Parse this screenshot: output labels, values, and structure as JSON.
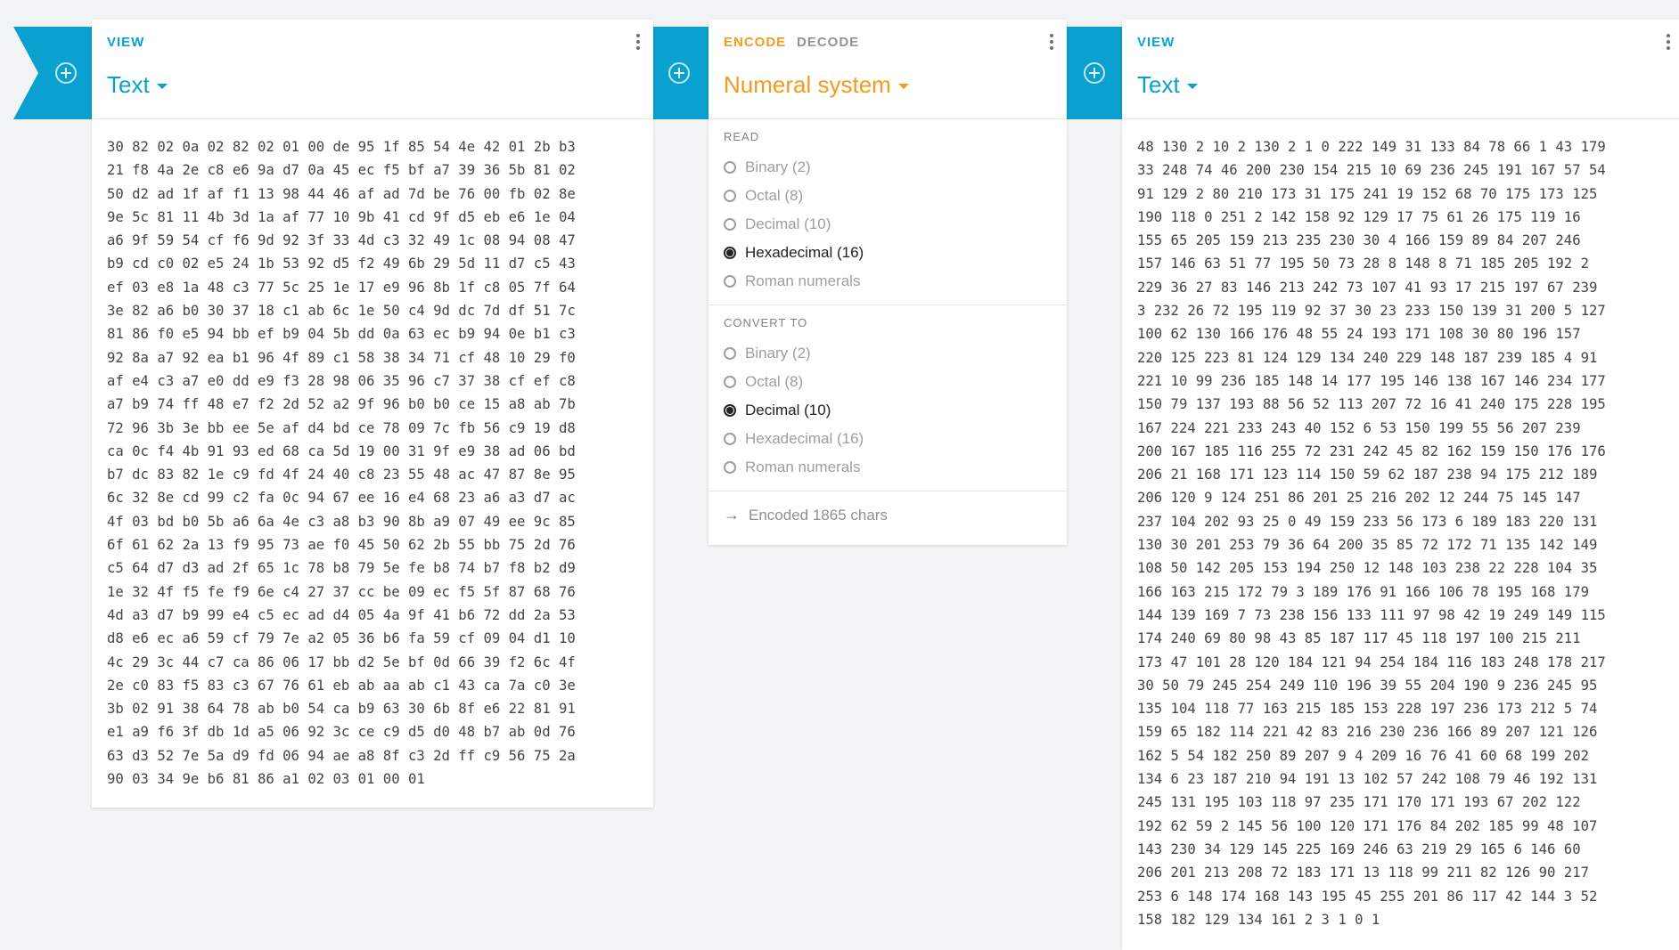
{
  "left_card": {
    "mode": "VIEW",
    "title": "Text",
    "content": "30 82 02 0a 02 82 02 01 00 de 95 1f 85 54 4e 42 01 2b b3\n21 f8 4a 2e c8 e6 9a d7 0a 45 ec f5 bf a7 39 36 5b 81 02\n50 d2 ad 1f af f1 13 98 44 46 af ad 7d be 76 00 fb 02 8e\n9e 5c 81 11 4b 3d 1a af 77 10 9b 41 cd 9f d5 eb e6 1e 04\na6 9f 59 54 cf f6 9d 92 3f 33 4d c3 32 49 1c 08 94 08 47\nb9 cd c0 02 e5 24 1b 53 92 d5 f2 49 6b 29 5d 11 d7 c5 43\nef 03 e8 1a 48 c3 77 5c 25 1e 17 e9 96 8b 1f c8 05 7f 64\n3e 82 a6 b0 30 37 18 c1 ab 6c 1e 50 c4 9d dc 7d df 51 7c\n81 86 f0 e5 94 bb ef b9 04 5b dd 0a 63 ec b9 94 0e b1 c3\n92 8a a7 92 ea b1 96 4f 89 c1 58 38 34 71 cf 48 10 29 f0\naf e4 c3 a7 e0 dd e9 f3 28 98 06 35 96 c7 37 38 cf ef c8\na7 b9 74 ff 48 e7 f2 2d 52 a2 9f 96 b0 b0 ce 15 a8 ab 7b\n72 96 3b 3e bb ee 5e af d4 bd ce 78 09 7c fb 56 c9 19 d8\nca 0c f4 4b 91 93 ed 68 ca 5d 19 00 31 9f e9 38 ad 06 bd\nb7 dc 83 82 1e c9 fd 4f 24 40 c8 23 55 48 ac 47 87 8e 95\n6c 32 8e cd 99 c2 fa 0c 94 67 ee 16 e4 68 23 a6 a3 d7 ac\n4f 03 bd b0 5b a6 6a 4e c3 a8 b3 90 8b a9 07 49 ee 9c 85\n6f 61 62 2a 13 f9 95 73 ae f0 45 50 62 2b 55 bb 75 2d 76\nc5 64 d7 d3 ad 2f 65 1c 78 b8 79 5e fe b8 74 b7 f8 b2 d9\n1e 32 4f f5 fe f9 6e c4 27 37 cc be 09 ec f5 5f 87 68 76\n4d a3 d7 b9 99 e4 c5 ec ad d4 05 4a 9f 41 b6 72 dd 2a 53\nd8 e6 ec a6 59 cf 79 7e a2 05 36 b6 fa 59 cf 09 04 d1 10\n4c 29 3c 44 c7 ca 86 06 17 bb d2 5e bf 0d 66 39 f2 6c 4f\n2e c0 83 f5 83 c3 67 76 61 eb ab aa ab c1 43 ca 7a c0 3e\n3b 02 91 38 64 78 ab b0 54 ca b9 63 30 6b 8f e6 22 81 91\ne1 a9 f6 3f db 1d a5 06 92 3c ce c9 d5 d0 48 b7 ab 0d 76\n63 d3 52 7e 5a d9 fd 06 94 ae a8 8f c3 2d ff c9 56 75 2a\n90 03 34 9e b6 81 86 a1 02 03 01 00 01"
  },
  "middle_card": {
    "encode_label": "ENCODE",
    "decode_label": "DECODE",
    "title": "Numeral system",
    "read_label": "READ",
    "read_options": [
      "Binary (2)",
      "Octal (8)",
      "Decimal (10)",
      "Hexadecimal (16)",
      "Roman numerals"
    ],
    "read_selected": "Hexadecimal (16)",
    "convert_label": "CONVERT TO",
    "convert_options": [
      "Binary (2)",
      "Octal (8)",
      "Decimal (10)",
      "Hexadecimal (16)",
      "Roman numerals"
    ],
    "convert_selected": "Decimal (10)",
    "status": "Encoded 1865 chars"
  },
  "right_card": {
    "mode": "VIEW",
    "title": "Text",
    "content": "48 130 2 10 2 130 2 1 0 222 149 31 133 84 78 66 1 43 179\n33 248 74 46 200 230 154 215 10 69 236 245 191 167 57 54\n91 129 2 80 210 173 31 175 241 19 152 68 70 175 173 125\n190 118 0 251 2 142 158 92 129 17 75 61 26 175 119 16\n155 65 205 159 213 235 230 30 4 166 159 89 84 207 246\n157 146 63 51 77 195 50 73 28 8 148 8 71 185 205 192 2\n229 36 27 83 146 213 242 73 107 41 93 17 215 197 67 239\n3 232 26 72 195 119 92 37 30 23 233 150 139 31 200 5 127\n100 62 130 166 176 48 55 24 193 171 108 30 80 196 157\n220 125 223 81 124 129 134 240 229 148 187 239 185 4 91\n221 10 99 236 185 148 14 177 195 146 138 167 146 234 177\n150 79 137 193 88 56 52 113 207 72 16 41 240 175 228 195\n167 224 221 233 243 40 152 6 53 150 199 55 56 207 239\n200 167 185 116 255 72 231 242 45 82 162 159 150 176 176\n206 21 168 171 123 114 150 59 62 187 238 94 175 212 189\n206 120 9 124 251 86 201 25 216 202 12 244 75 145 147\n237 104 202 93 25 0 49 159 233 56 173 6 189 183 220 131\n130 30 201 253 79 36 64 200 35 85 72 172 71 135 142 149\n108 50 142 205 153 194 250 12 148 103 238 22 228 104 35\n166 163 215 172 79 3 189 176 91 166 106 78 195 168 179\n144 139 169 7 73 238 156 133 111 97 98 42 19 249 149 115\n174 240 69 80 98 43 85 187 117 45 118 197 100 215 211\n173 47 101 28 120 184 121 94 254 184 116 183 248 178 217\n30 50 79 245 254 249 110 196 39 55 204 190 9 236 245 95\n135 104 118 77 163 215 185 153 228 197 236 173 212 5 74\n159 65 182 114 221 42 83 216 230 236 166 89 207 121 126\n162 5 54 182 250 89 207 9 4 209 16 76 41 60 68 199 202\n134 6 23 187 210 94 191 13 102 57 242 108 79 46 192 131\n245 131 195 103 118 97 235 171 170 171 193 67 202 122\n192 62 59 2 145 56 100 120 171 176 84 202 185 99 48 107\n143 230 34 129 145 225 169 246 63 219 29 165 6 146 60\n206 201 213 208 72 183 171 13 118 99 211 82 126 90 217\n253 6 148 174 168 143 195 45 255 201 86 117 42 144 3 52\n158 182 129 134 161 2 3 1 0 1"
  },
  "colors": {
    "accent_blue": "#0aa0cf",
    "accent_orange": "#f39a1f"
  },
  "icons": {
    "connector": "plus-circle-icon",
    "menu": "more-vert-icon",
    "status_arrow": "arrow-right-icon",
    "dropdown": "caret-down-icon"
  }
}
